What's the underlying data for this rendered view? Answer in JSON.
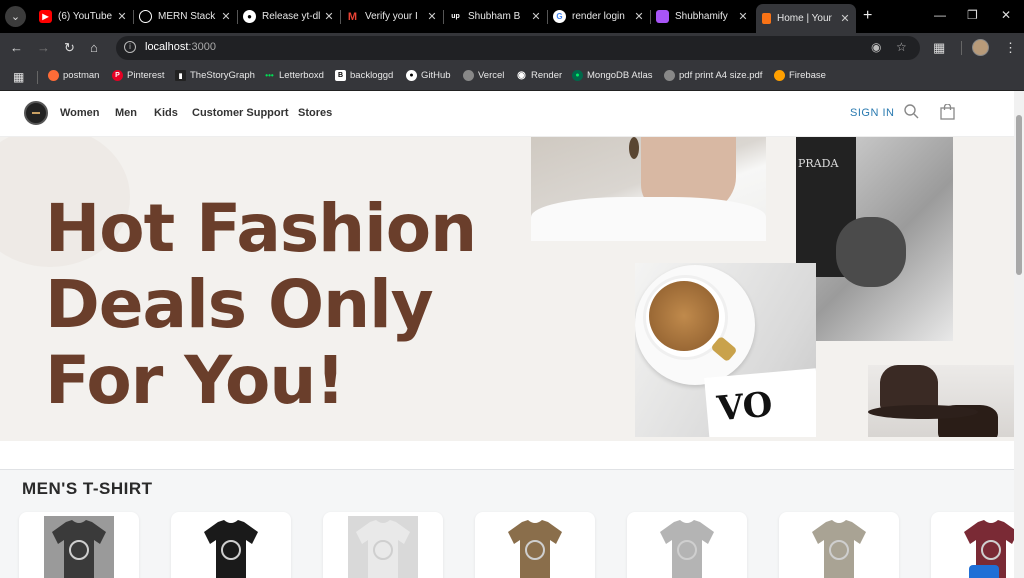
{
  "browser": {
    "tabs": [
      {
        "label": "(6) YouTube",
        "icon": "youtube-icon",
        "color": "#ff0000"
      },
      {
        "label": "MERN Stack",
        "icon": "openai-icon",
        "color": "#ffffff"
      },
      {
        "label": "Release yt-dl",
        "icon": "github-icon",
        "color": "#ffffff"
      },
      {
        "label": "Verify your I",
        "icon": "gmail-icon",
        "color": "#ea4335"
      },
      {
        "label": "Shubham B",
        "icon": "upwork-icon",
        "color": "#ffffff"
      },
      {
        "label": "render login",
        "icon": "google-icon",
        "color": "#4285f4"
      },
      {
        "label": "Shubhamify",
        "icon": "shubhamify-icon",
        "color": "#a855f7"
      },
      {
        "label": "Home | Your",
        "icon": "site-icon",
        "color": "#f97316"
      }
    ],
    "url_host": "localhost",
    "url_port": ":3000",
    "bookmarks": [
      {
        "label": "postman",
        "icon": "postman-icon",
        "color": "#ff6c37"
      },
      {
        "label": "Pinterest",
        "icon": "pinterest-icon",
        "color": "#e60023"
      },
      {
        "label": "TheStoryGraph",
        "icon": "storygraph-icon",
        "color": "#ffffff"
      },
      {
        "label": "Letterboxd",
        "icon": "letterboxd-icon",
        "color": "#00e054"
      },
      {
        "label": "backloggd",
        "icon": "backloggd-icon",
        "color": "#ffffff"
      },
      {
        "label": "GitHub",
        "icon": "github-icon",
        "color": "#ffffff"
      },
      {
        "label": "Vercel",
        "icon": "globe-icon",
        "color": "#cccccc"
      },
      {
        "label": "Render",
        "icon": "render-icon",
        "color": "#ffffff"
      },
      {
        "label": "MongoDB Atlas",
        "icon": "mongodb-icon",
        "color": "#00ed64"
      },
      {
        "label": "pdf print A4 size.pdf",
        "icon": "globe-icon",
        "color": "#cccccc"
      },
      {
        "label": "Firebase",
        "icon": "firebase-icon",
        "color": "#ffa000"
      }
    ]
  },
  "site": {
    "nav": [
      "Women",
      "Men",
      "Kids",
      "Customer Support",
      "Stores"
    ],
    "sign_in": "SIGN IN",
    "hero_lines": [
      "Hot Fashion",
      "Deals Only",
      "For You!"
    ],
    "photo_bag_brand": "PRADA",
    "photo_mag_title": "VO",
    "section_title": "MEN'S T-SHIRT",
    "products": [
      {
        "color": "#3a3a3a",
        "bg": "#9a9a9a"
      },
      {
        "color": "#1a1a1a",
        "bg": "#ffffff"
      },
      {
        "color": "#e9e9e9",
        "bg": "#d9d9d9"
      },
      {
        "color": "#8a6e4b",
        "bg": "#ffffff"
      },
      {
        "color": "#b4b4b4",
        "bg": "#ffffff"
      },
      {
        "color": "#a9a394",
        "bg": "#ffffff"
      },
      {
        "color": "#7a2a35",
        "bg": "#ffffff"
      }
    ]
  },
  "colors": {
    "brand_brown": "#6a3e2b",
    "signin_blue": "#2a7ab0",
    "hero_bg": "#f3f1ee"
  }
}
